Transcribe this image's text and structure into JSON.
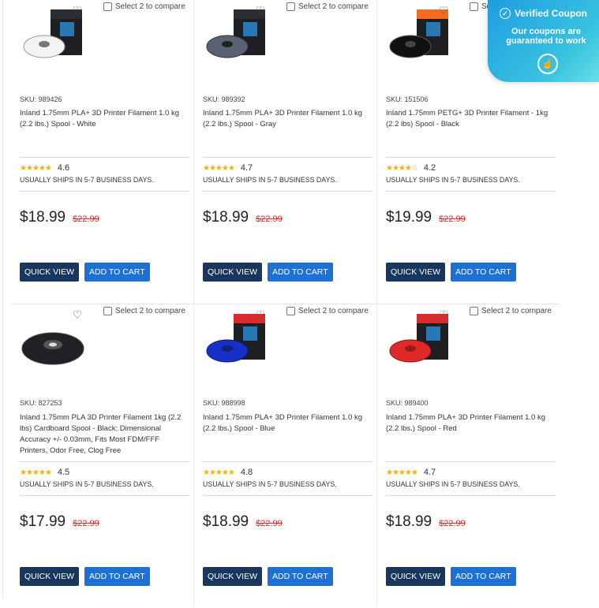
{
  "compare_label": "Select 2 to compare",
  "quick_view_label": "QUICK VIEW",
  "add_to_cart_label": "ADD TO CART",
  "coupon": {
    "title": "Verified Coupon",
    "subtitle": "Our coupons are guaranteed to work"
  },
  "products": [
    {
      "sku": "SKU: 989426",
      "title": "Inland 1.75mm PLA+ 3D Printer Filament 1.0 kg (2.2 lbs.) Spool - White",
      "rating": "4.6",
      "stars": "★★★★★",
      "shipping": "USUALLY SHIPS IN 5-7 BUSINESS DAYS.",
      "price": "$18.99",
      "old_price": "$22.99",
      "color": "#f3f3f3"
    },
    {
      "sku": "SKU: 989392",
      "title": "Inland 1.75mm PLA+ 3D Printer Filament 1.0 kg (2.2 lbs.) Spool - Gray",
      "rating": "4.7",
      "stars": "★★★★★",
      "shipping": "USUALLY SHIPS IN 5-7 BUSINESS DAYS.",
      "price": "$18.99",
      "old_price": "$22.99",
      "color": "#596273"
    },
    {
      "sku": "SKU: 151506",
      "title": "Inland 1.75mm PETG+ 3D Printer Filament - 1kg (2.2 lbs) Spool - Black",
      "rating": "4.2",
      "stars": "★★★★☆",
      "shipping": "USUALLY SHIPS IN 5-7 BUSINESS DAYS.",
      "price": "$19.99",
      "old_price": "$22.99",
      "color": "#111111"
    },
    {
      "sku": "SKU: 827253",
      "title": "Inland 1.75mm PLA 3D Printer Filament 1kg (2.2 lbs) Cardboard Spool - Black; Dimensional Accuracy +/- 0.03mm, Fits Most FDM/FFF Printers, Odor Free, Clog Free",
      "rating": "4.5",
      "stars": "★★★★★",
      "shipping": "USUALLY SHIPS IN 5-7 BUSINESS DAYS.",
      "price": "$17.99",
      "old_price": "$22.99",
      "color": "#1f2124"
    },
    {
      "sku": "SKU: 988998",
      "title": "Inland 1.75mm PLA+ 3D Printer Filament 1.0 kg (2.2 lbs.) Spool - Blue",
      "rating": "4.8",
      "stars": "★★★★★",
      "shipping": "USUALLY SHIPS IN 5-7 BUSINESS DAYS.",
      "price": "$18.99",
      "old_price": "$22.99",
      "color": "#1730c7"
    },
    {
      "sku": "SKU: 989400",
      "title": "Inland 1.75mm PLA+ 3D Printer Filament 1.0 kg (2.2 lbs.) Spool - Red",
      "rating": "4.7",
      "stars": "★★★★★",
      "shipping": "USUALLY SHIPS IN 5-7 BUSINESS DAYS.",
      "price": "$18.99",
      "old_price": "$22.99",
      "color": "#e02929"
    }
  ]
}
